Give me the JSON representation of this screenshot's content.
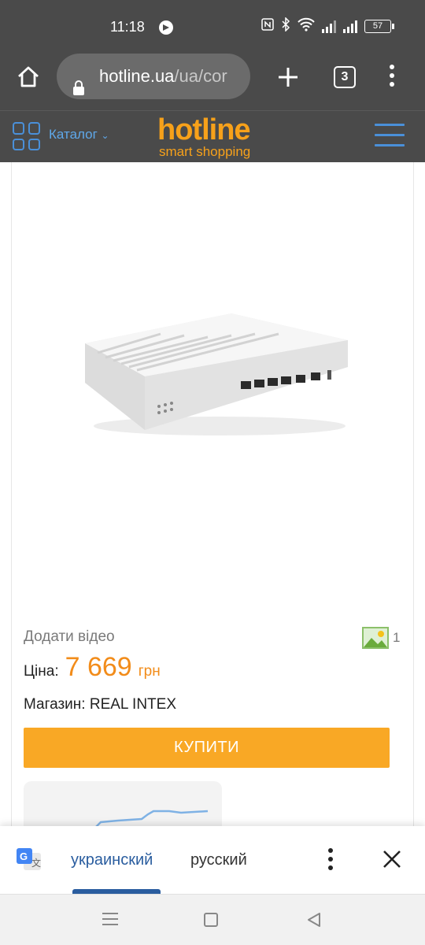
{
  "status_bar": {
    "time": "11:18",
    "battery": "57",
    "icons": [
      "notification-icon",
      "nfc-icon",
      "bluetooth-icon",
      "wifi-icon",
      "signal-icon",
      "signal-icon",
      "battery-icon"
    ]
  },
  "browser": {
    "url_host": "hotline.ua",
    "url_path": "/ua/cor",
    "tab_count": "3"
  },
  "site_header": {
    "catalog_label": "Каталог",
    "logo_main": "hotline",
    "logo_sub": "smart shopping",
    "accent_color": "#f7a11a",
    "icon_color": "#4a90d9"
  },
  "product": {
    "add_video": "Додати відео",
    "gallery_count": "1",
    "price_label": "Ціна:",
    "price_value": "7 669",
    "price_currency": "грн",
    "shop_label": "Магазин: REAL INTEX",
    "buy_label": "КУПИТИ",
    "buy_color": "#f9a825"
  },
  "translate_bar": {
    "lang_active": "украинский",
    "lang_other": "русский"
  }
}
